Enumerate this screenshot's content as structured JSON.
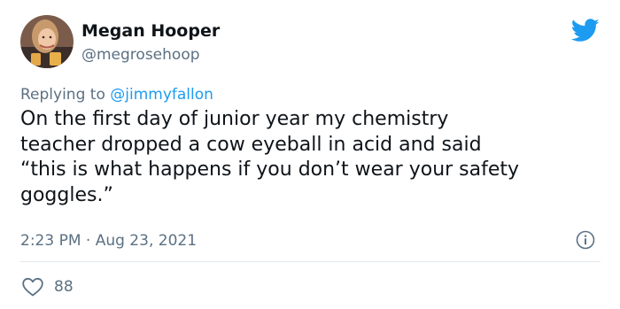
{
  "author": {
    "display_name": "Megan Hooper",
    "handle": "@megrosehoop"
  },
  "reply": {
    "prefix": "Replying to ",
    "mention": "@jimmyfallon"
  },
  "tweet": {
    "text": "On the first day of junior year my chemistry\nteacher dropped a cow eyeball in acid and said\n“this is what happens if you don’t wear your safety\ngoggles.”"
  },
  "meta": {
    "timestamp": "2:23 PM · Aug 23, 2021"
  },
  "engagement": {
    "likes": "88"
  },
  "icons": {
    "brand": "twitter-bird-icon",
    "info": "info-icon",
    "like": "heart-icon"
  },
  "colors": {
    "brand": "#1d9bf0",
    "secondary_text": "#5b7083",
    "divider": "#e1e8ed"
  }
}
